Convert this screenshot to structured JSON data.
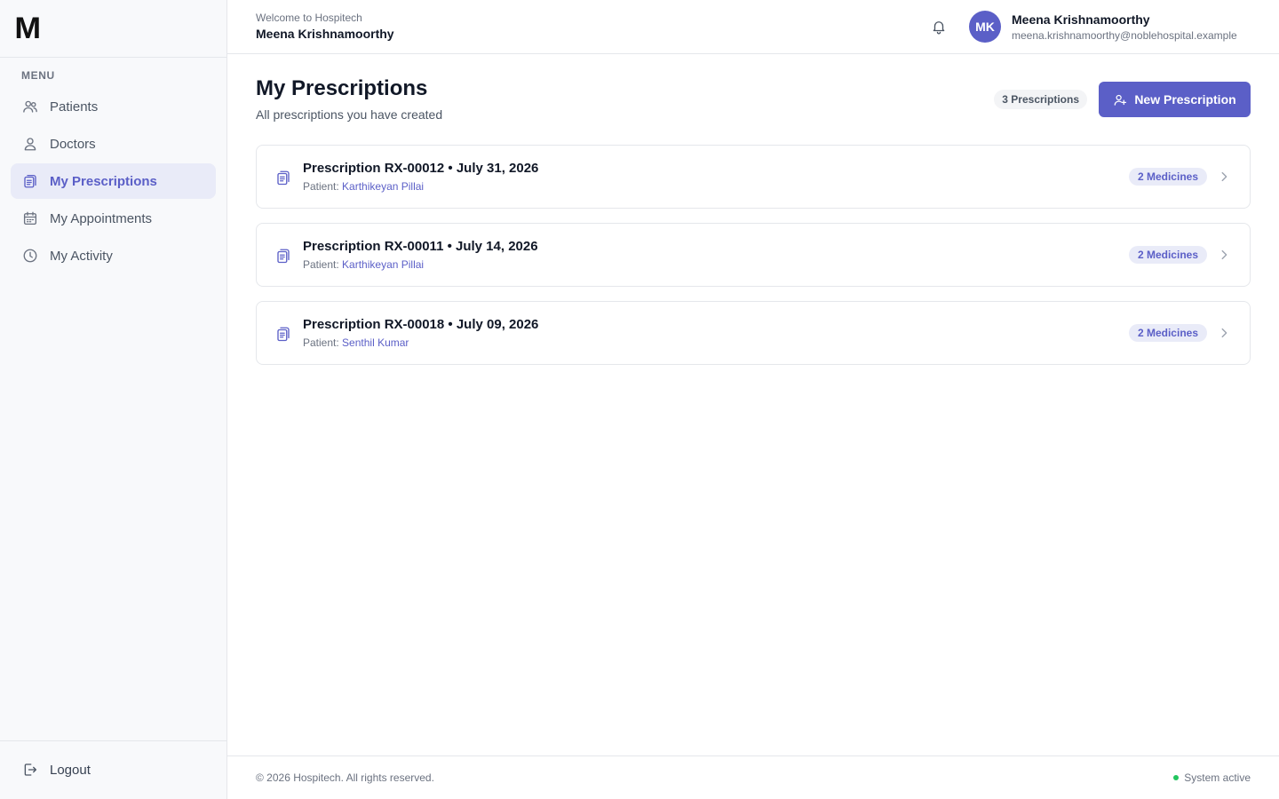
{
  "brand": {
    "logo_text": "M"
  },
  "sidebar": {
    "menu_label": "MENU",
    "items": [
      {
        "label": "Patients",
        "icon": "users-icon",
        "active": false
      },
      {
        "label": "Doctors",
        "icon": "user-icon",
        "active": false
      },
      {
        "label": "My Prescriptions",
        "icon": "clipboard-icon",
        "active": true
      },
      {
        "label": "My Appointments",
        "icon": "calendar-icon",
        "active": false
      },
      {
        "label": "My Activity",
        "icon": "clock-icon",
        "active": false
      }
    ],
    "logout_label": "Logout"
  },
  "header": {
    "welcome_text": "Welcome to Hospitech",
    "welcome_name": "Meena Krishnamoorthy",
    "avatar_initials": "MK",
    "user_name": "Meena Krishnamoorthy",
    "user_email": "meena.krishnamoorthy@noblehospital.example"
  },
  "main": {
    "title": "My Prescriptions",
    "subtitle": "All prescriptions you have created",
    "count_badge": "3 Prescriptions",
    "new_button_label": "New Prescription",
    "patient_prefix": "Patient:",
    "prescriptions": [
      {
        "title": "Prescription RX-00012 • July 31, 2026",
        "patient": "Karthikeyan Pillai",
        "medicines": "2 Medicines"
      },
      {
        "title": "Prescription RX-00011 • July 14, 2026",
        "patient": "Karthikeyan Pillai",
        "medicines": "2 Medicines"
      },
      {
        "title": "Prescription RX-00018 • July 09, 2026",
        "patient": "Senthil Kumar",
        "medicines": "2 Medicines"
      }
    ]
  },
  "footer": {
    "copyright": "© 2026 Hospitech. All rights reserved.",
    "status": "System active"
  },
  "colors": {
    "accent": "#5b5fc7",
    "accent_light": "#e9ebf8",
    "status_ok": "#22c55e"
  }
}
